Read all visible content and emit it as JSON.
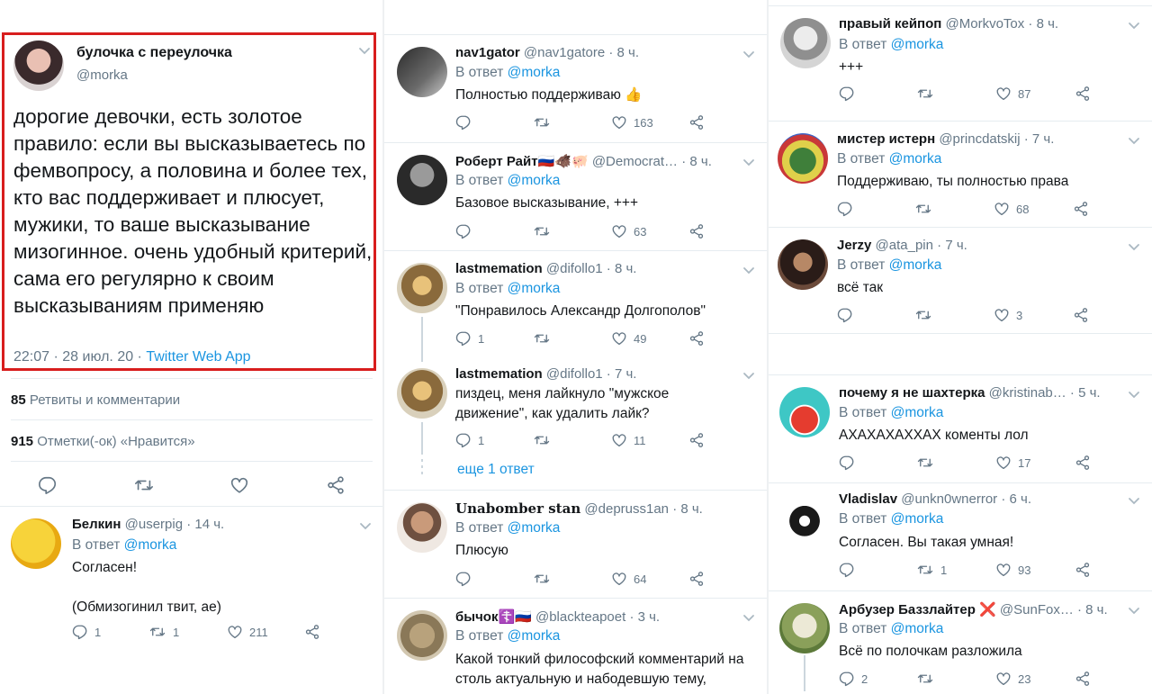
{
  "main_tweet": {
    "name": "булочка с переулочка",
    "handle": "@morka",
    "text": "дорогие девочки, есть золотое правило: если вы высказываетесь по фемвопросу, а половина и более тех, кто вас поддерживает и плюсует, мужики, то ваше высказывание мизогинное. очень удобный критерий, сама его регулярно к своим высказываниям применяю",
    "time": "22:07 · 28 июл. 20 · ",
    "source": "Twitter Web App",
    "retweets_count": "85",
    "retweets_label": " Ретвиты и комментарии",
    "likes_count": "915",
    "likes_label": " Отметки(-ок) «Нравится»"
  },
  "reply_prefix": "В ответ ",
  "reply_handle": "@morka",
  "more_replies": "еще 1 ответ",
  "col1": [
    {
      "name": "Белкин",
      "handle": "@userpig",
      "time": " · 14 ч.",
      "text": "Согласен!",
      "text2": "(Обмизогинил твит, ае)",
      "replies": "1",
      "retweets": "1",
      "likes": "211"
    }
  ],
  "col2": [
    {
      "name": "nav1gator",
      "handle": "@nav1gatore",
      "time": " · 8 ч.",
      "text": "Полностью поддерживаю 👍",
      "replies": "",
      "retweets": "",
      "likes": "163"
    },
    {
      "name": "Роберт Райт🇷🇺🐗🐖",
      "handle": "@Democrat…",
      "time": " · 8 ч.",
      "text": "Базовое высказывание, +++",
      "replies": "",
      "retweets": "",
      "likes": "63"
    },
    {
      "name": "lastmemation",
      "handle": "@difollo1",
      "time": " · 8 ч.",
      "text": "\"Понравилось Александр Долгополов\"",
      "replies": "1",
      "retweets": "",
      "likes": "49"
    },
    {
      "name": "lastmemation",
      "handle": "@difollo1",
      "time": " · 7 ч.",
      "text": "пиздец, меня лайкнуло \"мужское движение\", как удалить лайк?",
      "replies": "1",
      "retweets": "",
      "likes": "11"
    },
    {
      "name": "Unabomber stan",
      "handle": "@depruss1an",
      "time": " · 8 ч.",
      "text": "Плюсую",
      "replies": "",
      "retweets": "",
      "likes": "64"
    },
    {
      "name": "бычок☦️🇷🇺",
      "handle": "@blackteapoet",
      "time": " · 3 ч.",
      "text": "Какой тонкий философский комментарий на столь актуальную и набодевшую тему,",
      "replies": "",
      "retweets": "",
      "likes": ""
    }
  ],
  "col3": [
    {
      "name": "правый кейпоп",
      "handle": "@MorkvoTox",
      "time": " · 8 ч.",
      "text": "+++",
      "replies": "",
      "retweets": "",
      "likes": "87"
    },
    {
      "name": "мистер истерн",
      "handle": "@princdatskij",
      "time": " · 7 ч.",
      "text": "Поддерживаю, ты полностью права",
      "replies": "",
      "retweets": "",
      "likes": "68"
    },
    {
      "name": "Jerzy",
      "handle": "@ata_pin",
      "time": " · 7 ч.",
      "text": "всё так",
      "replies": "",
      "retweets": "",
      "likes": "3"
    },
    {
      "name": "почему я не шахтерка",
      "handle": "@kristinab…",
      "time": " · 5 ч.",
      "text": "АХАХАХАХХАХ коменты лол",
      "replies": "",
      "retweets": "",
      "likes": "17"
    },
    {
      "name": "Vladislav",
      "handle": "@unkn0wnerror",
      "time": " · 6 ч.",
      "text": "Согласен. Вы такая умная!",
      "replies": "",
      "retweets": "1",
      "likes": "93"
    },
    {
      "name": "Арбузер Баззлайтер ❌",
      "handle": "@SunFox…",
      "time": " · 8 ч.",
      "text": "Всё по полочкам разложила",
      "replies": "2",
      "retweets": "",
      "likes": "23"
    }
  ]
}
